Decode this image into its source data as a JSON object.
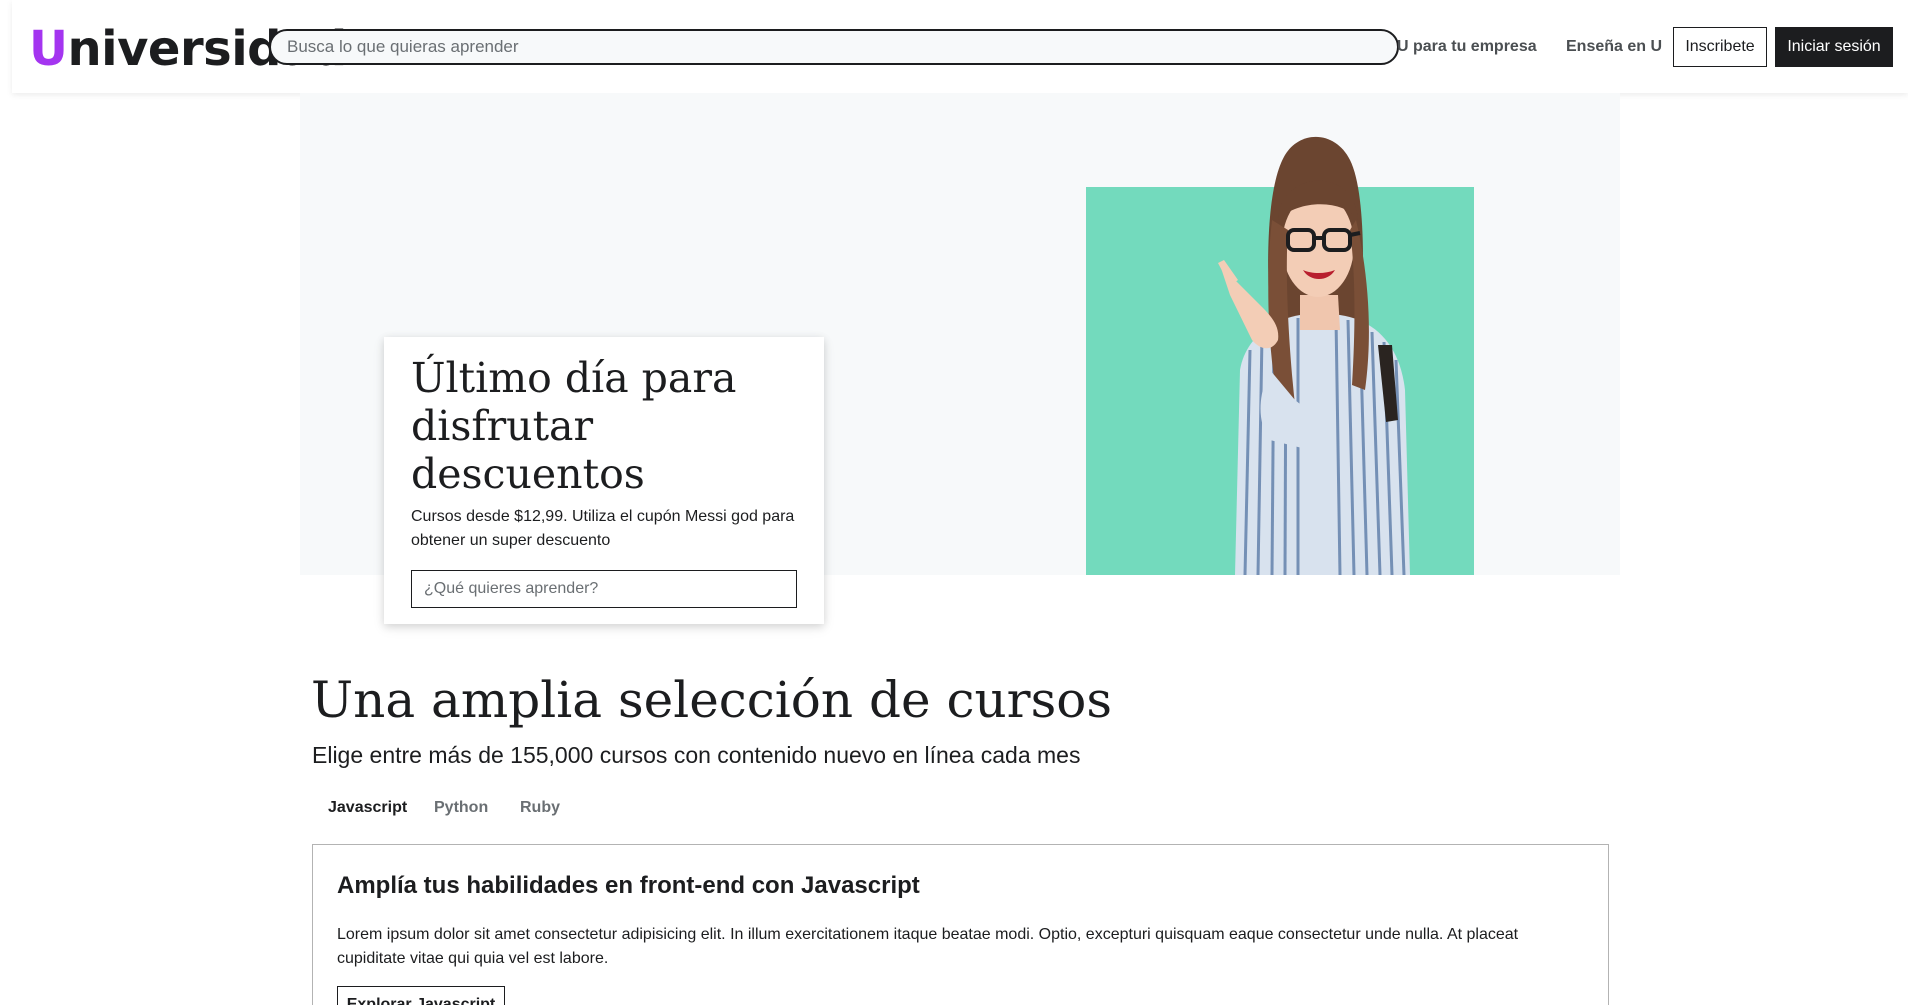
{
  "header": {
    "logo_initial": "U",
    "logo_rest": "niversidad",
    "search_placeholder": "Busca lo que quieras aprender",
    "nav_business": "U para tu empresa",
    "nav_teach": "Enseña en U",
    "signup_label": "Inscribete",
    "login_label": "Iniciar sesión"
  },
  "hero": {
    "title": "Último día para disfrutar descuentos",
    "text": "Cursos desde $12,99. Utiliza el cupón Messi god para obtener un super descuento",
    "search_placeholder": "¿Qué quieres aprender?",
    "image_label": "woman-pointing-photo"
  },
  "courses": {
    "title": "Una amplia selección de cursos",
    "subtitle": "Elige entre más de 155,000 cursos con contenido nuevo en línea cada mes",
    "tabs": [
      {
        "label": "Javascript",
        "active": true
      },
      {
        "label": "Python",
        "active": false
      },
      {
        "label": "Ruby",
        "active": false
      }
    ],
    "panel": {
      "title": "Amplía tus habilidades en front-end con Javascript",
      "text": "Lorem ipsum dolor sit amet consectetur adipisicing elit. In illum exercitationem itaque beatae modi. Optio, excepturi quisquam eaque consectetur unde nulla. At placeat cupiditate vitae qui quia vel est labore.",
      "button_label": "Explorar Javascript"
    }
  },
  "colors": {
    "brand": "#a435f0",
    "hero_accent": "#73dabd",
    "dark": "#1c1d1f",
    "hero_bg": "#f7f9fa"
  }
}
